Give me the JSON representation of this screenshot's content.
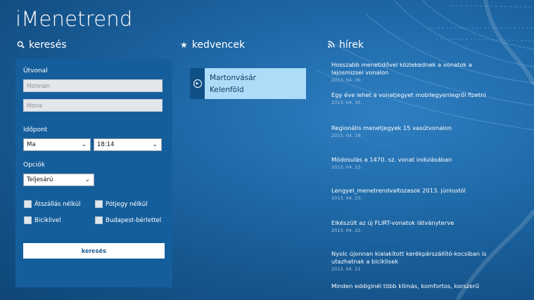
{
  "app": {
    "title": "iMenetrend"
  },
  "sections": {
    "search": {
      "label": "keresés",
      "icon": "search-icon"
    },
    "favorites": {
      "label": "kedvencek",
      "icon": "star-icon"
    },
    "news": {
      "label": "hírek",
      "icon": "rss-icon"
    }
  },
  "search_form": {
    "route_label": "Útvonal",
    "from_placeholder": "Honnan",
    "to_placeholder": "Hova",
    "time_label": "Időpont",
    "day_value": "Ma",
    "time_value": "18:14",
    "options_label": "Opciók",
    "fare_value": "Teljesárú",
    "checkboxes": [
      {
        "label": "Átszállás nélkül",
        "checked": false
      },
      {
        "label": "Pótjegy nélkül",
        "checked": false
      },
      {
        "label": "Biciklivel",
        "checked": false
      },
      {
        "label": "Budapest-bérlettel",
        "checked": false
      }
    ],
    "submit_label": "keresés"
  },
  "favorites": [
    {
      "from": "Martonvásár",
      "to": "Kelenföld",
      "icon": "play-circle-icon"
    }
  ],
  "news": [
    {
      "title": "Hosszabb menetidővel közlekednek a vonatok a lajosmizsei vonalon",
      "date": "2013. 04. 30."
    },
    {
      "title": "Egy éve lehet a vonatjegyet mobilegyenlegről fizetni",
      "date": "2013. 04. 30."
    },
    {
      "title": "Regionális menetjegyek 15 vasútvonalon",
      "date": "2013. 04. 28."
    },
    {
      "title": "Módosulás a 1470. sz. vonat indulásában",
      "date": "2013. 04. 23."
    },
    {
      "title": "Lengyel_menetrendvaltozasok 2013. júniustól",
      "date": "2013. 04. 23."
    },
    {
      "title": "Elkészült az új FLIRT-vonatok látványterve",
      "date": "2013. 04. 22."
    },
    {
      "title": "Nyolc újonnan kialakított kerékpárszállító-kocsiban is utazhatnak a biciklisek",
      "date": "2013. 04. 21."
    },
    {
      "title": "Minden eddiginél több klímás, komfortos, korszerű",
      "date": ""
    }
  ],
  "colors": {
    "background": "#1f6aa9",
    "panel": "#155e9c",
    "favorite_card": "#acdcf8",
    "accent_dark": "#0f4f86"
  }
}
